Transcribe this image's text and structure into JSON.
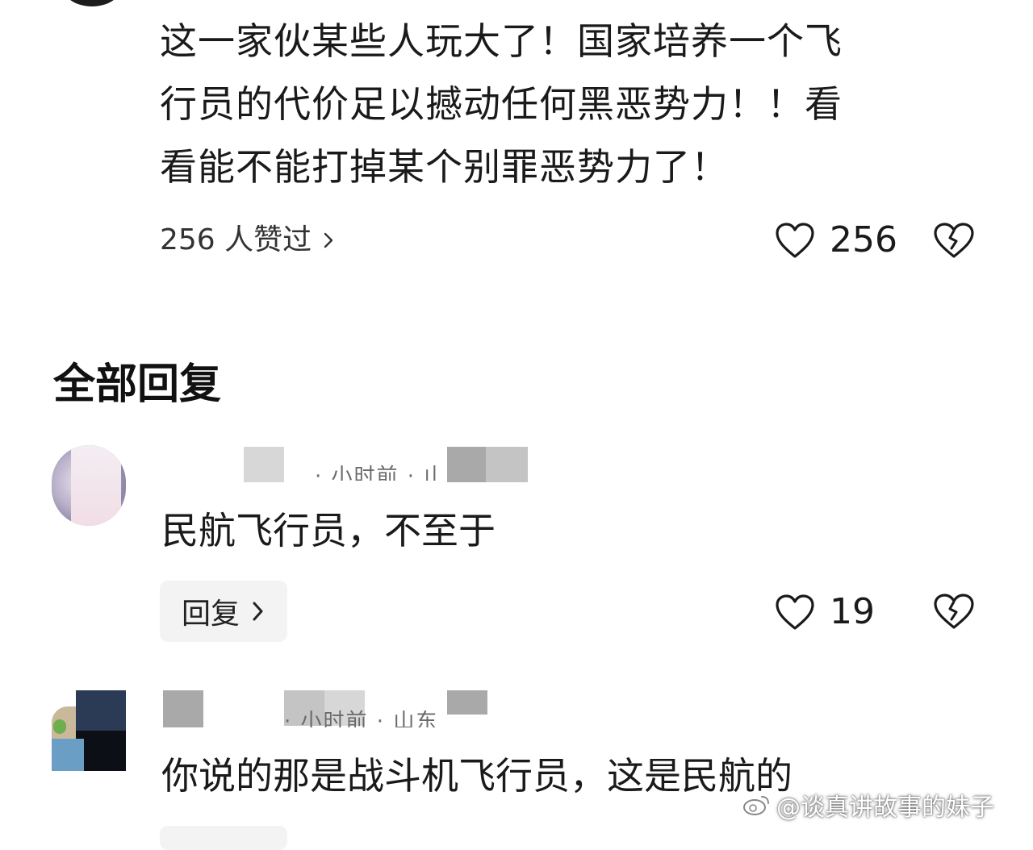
{
  "comment": {
    "text_lines": [
      "这一家伙某些人玩大了！国家培养一个飞",
      "行员的代价足以撼动任何黑恶势力！！看",
      "看能不能打掉某个别罪恶势力了！"
    ],
    "likes_summary": "256 人赞过",
    "like_count": "256"
  },
  "replies_section": {
    "title": "全部回复"
  },
  "replies": [
    {
      "meta_faint": "· 小时前 · 山东",
      "text": "民航飞行员，不至于",
      "reply_button_label": "回复",
      "like_count": "19"
    },
    {
      "meta_faint": "· 小时前 · 山东",
      "text": "你说的那是战斗机飞行员，这是民航的"
    }
  ],
  "watermark": {
    "text": "@谈真讲故事的妹子"
  },
  "icons": {
    "like": "heart-outline-icon",
    "dislike": "broken-heart-icon",
    "more": "chevron-right-icon",
    "brand": "weibo-icon"
  },
  "colors": {
    "text": "#1a1a1a",
    "secondary": "#333333",
    "button_bg": "#f3f3f3"
  }
}
